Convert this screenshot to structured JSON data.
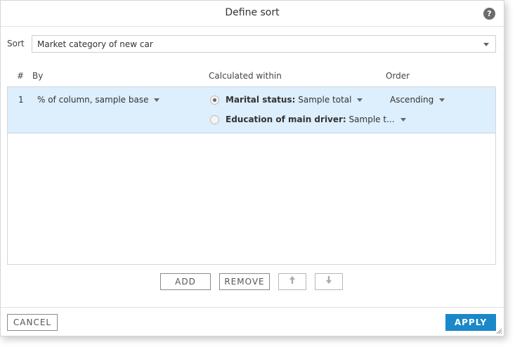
{
  "dialog": {
    "title": "Define sort",
    "help_label": "?"
  },
  "sort": {
    "label": "Sort",
    "selected": "Market category of new car"
  },
  "table": {
    "headers": {
      "num": "#",
      "by": "By",
      "calculated_within": "Calculated within",
      "order": "Order"
    },
    "rows": [
      {
        "num": "1",
        "by": "% of column, sample base",
        "calc": [
          {
            "label": "Marital status:",
            "value": " Sample total",
            "checked": true
          },
          {
            "label": "Education of main driver:",
            "value": " Sample t...",
            "checked": false
          }
        ],
        "order": "Ascending"
      }
    ]
  },
  "buttons": {
    "add": "ADD",
    "remove": "REMOVE",
    "move_up": "🠕",
    "move_down": "🠗",
    "cancel": "CANCEL",
    "apply": "APPLY"
  },
  "colors": {
    "accent": "#1a88c9",
    "row_selected": "#ddeefc"
  }
}
